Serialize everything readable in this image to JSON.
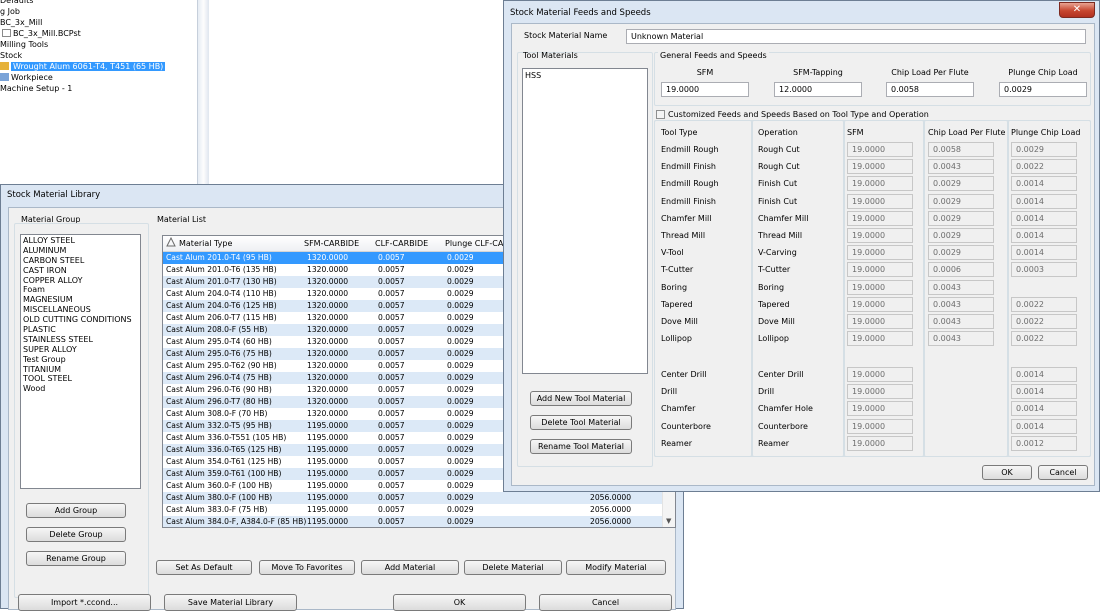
{
  "tree": {
    "items": [
      {
        "label": "Defaults",
        "indent": 0
      },
      {
        "label": "g Job",
        "indent": 0
      },
      {
        "label": "BC_3x_Mill",
        "indent": 0
      },
      {
        "label": "BC_3x_Mill.BCPst",
        "indent": 1
      },
      {
        "label": "Milling Tools",
        "indent": 0
      },
      {
        "label": "Stock",
        "indent": 0
      },
      {
        "label": "Wrought Alum 6061-T4, T451 (65 HB)",
        "indent": 1
      },
      {
        "label": "Workpiece",
        "indent": 1
      },
      {
        "label": "Machine Setup - 1",
        "indent": 0
      }
    ]
  },
  "library": {
    "title": "Stock Material Library",
    "material_group_label": "Material Group",
    "material_list_label": "Material List",
    "groups": [
      "ALLOY STEEL",
      "ALUMINUM",
      "CARBON STEEL",
      "CAST IRON",
      "COPPER ALLOY",
      "Foam",
      "MAGNESIUM",
      "MISCELLANEOUS",
      "OLD CUTTING CONDITIONS",
      "PLASTIC",
      "STAINLESS STEEL",
      "SUPER ALLOY",
      "Test Group",
      "TITANIUM",
      "TOOL STEEL",
      "Wood"
    ],
    "columns": [
      "Material Type",
      "SFM-CARBIDE",
      "CLF-CARBIDE",
      "Plunge CLF-CARBIDE"
    ],
    "rows": [
      [
        "Cast Alum 201.0-T4 (95 HB)",
        "1320.0000",
        "0.0057",
        "0.0029",
        ""
      ],
      [
        "Cast Alum 201.0-T6 (135 HB)",
        "1320.0000",
        "0.0057",
        "0.0029",
        ""
      ],
      [
        "Cast Alum 201.0-T7 (130 HB)",
        "1320.0000",
        "0.0057",
        "0.0029",
        ""
      ],
      [
        "Cast Alum 204.0-T4 (110 HB)",
        "1320.0000",
        "0.0057",
        "0.0029",
        ""
      ],
      [
        "Cast Alum 204.0-T6 (125 HB)",
        "1320.0000",
        "0.0057",
        "0.0029",
        ""
      ],
      [
        "Cast Alum 206.0-T7 (115 HB)",
        "1320.0000",
        "0.0057",
        "0.0029",
        ""
      ],
      [
        "Cast Alum 208.0-F (55 HB)",
        "1320.0000",
        "0.0057",
        "0.0029",
        ""
      ],
      [
        "Cast Alum 295.0-T4 (60 HB)",
        "1320.0000",
        "0.0057",
        "0.0029",
        ""
      ],
      [
        "Cast Alum 295.0-T6 (75 HB)",
        "1320.0000",
        "0.0057",
        "0.0029",
        ""
      ],
      [
        "Cast Alum 295.0-T62 (90 HB)",
        "1320.0000",
        "0.0057",
        "0.0029",
        ""
      ],
      [
        "Cast Alum 296.0-T4 (75 HB)",
        "1320.0000",
        "0.0057",
        "0.0029",
        ""
      ],
      [
        "Cast Alum 296.0-T6 (90 HB)",
        "1320.0000",
        "0.0057",
        "0.0029",
        ""
      ],
      [
        "Cast Alum 296.0-T7 (80 HB)",
        "1320.0000",
        "0.0057",
        "0.0029",
        ""
      ],
      [
        "Cast Alum 308.0-F (70 HB)",
        "1320.0000",
        "0.0057",
        "0.0029",
        ""
      ],
      [
        "Cast Alum 332.0-T5 (95 HB)",
        "1195.0000",
        "0.0057",
        "0.0029",
        ""
      ],
      [
        "Cast Alum 336.0-T551 (105 HB)",
        "1195.0000",
        "0.0057",
        "0.0029",
        ""
      ],
      [
        "Cast Alum 336.0-T65 (125 HB)",
        "1195.0000",
        "0.0057",
        "0.0029",
        ""
      ],
      [
        "Cast Alum 354.0-T61 (125 HB)",
        "1195.0000",
        "0.0057",
        "0.0029",
        ""
      ],
      [
        "Cast Alum 359.0-T61 (100 HB)",
        "1195.0000",
        "0.0057",
        "0.0029",
        ""
      ],
      [
        "Cast Alum 360.0-F (100 HB)",
        "1195.0000",
        "0.0057",
        "0.0029",
        ""
      ],
      [
        "Cast Alum 380.0-F (100 HB)",
        "1195.0000",
        "0.0057",
        "0.0029",
        "2056.0000"
      ],
      [
        "Cast Alum 383.0-F (75 HB)",
        "1195.0000",
        "0.0057",
        "0.0029",
        "2056.0000"
      ],
      [
        "Cast Alum 384.0-F, A384.0-F (85 HB)",
        "1195.0000",
        "0.0057",
        "0.0029",
        "2056.0000"
      ]
    ],
    "add_group": "Add Group",
    "delete_group": "Delete Group",
    "rename_group": "Rename Group",
    "set_default": "Set As Default",
    "move_favorites": "Move To Favorites",
    "add_material": "Add Material",
    "delete_material": "Delete Material",
    "modify_material": "Modify Material",
    "import": "Import *.ccond...",
    "save": "Save Material Library",
    "ok": "OK",
    "cancel": "Cancel"
  },
  "feeds": {
    "title": "Stock Material Feeds and Speeds",
    "close_glyph": "✕",
    "name_label": "Stock Material Name",
    "name_value": "Unknown Material",
    "tool_materials_label": "Tool Materials",
    "tool_materials": [
      "HSS"
    ],
    "general_label": "General Feeds and Speeds",
    "general": [
      {
        "label": "SFM",
        "value": "19.0000"
      },
      {
        "label": "SFM-Tapping",
        "value": "12.0000"
      },
      {
        "label": "Chip Load Per Flute",
        "value": "0.0058"
      },
      {
        "label": "Plunge Chip Load",
        "value": "0.0029"
      }
    ],
    "custom_label": "Customized Feeds and Speeds Based on Tool Type and Operation",
    "custom_headers": [
      "Tool Type",
      "Operation",
      "SFM",
      "Chip Load Per Flute",
      "Plunge Chip Load"
    ],
    "rows": [
      {
        "tool": "Endmill Rough",
        "op": "Rough Cut",
        "sfm": "19.0000",
        "clf": "0.0058",
        "plunge": "0.0029"
      },
      {
        "tool": "Endmill Finish",
        "op": "Rough Cut",
        "sfm": "19.0000",
        "clf": "0.0043",
        "plunge": "0.0022"
      },
      {
        "tool": "Endmill Rough",
        "op": "Finish Cut",
        "sfm": "19.0000",
        "clf": "0.0029",
        "plunge": "0.0014"
      },
      {
        "tool": "Endmill Finish",
        "op": "Finish Cut",
        "sfm": "19.0000",
        "clf": "0.0029",
        "plunge": "0.0014"
      },
      {
        "tool": "Chamfer Mill",
        "op": "Chamfer Mill",
        "sfm": "19.0000",
        "clf": "0.0029",
        "plunge": "0.0014"
      },
      {
        "tool": "Thread Mill",
        "op": "Thread Mill",
        "sfm": "19.0000",
        "clf": "0.0029",
        "plunge": "0.0014"
      },
      {
        "tool": "V-Tool",
        "op": "V-Carving",
        "sfm": "19.0000",
        "clf": "0.0029",
        "plunge": "0.0014"
      },
      {
        "tool": "T-Cutter",
        "op": "T-Cutter",
        "sfm": "19.0000",
        "clf": "0.0006",
        "plunge": "0.0003"
      },
      {
        "tool": "Boring",
        "op": "Boring",
        "sfm": "19.0000",
        "clf": "0.0043",
        "plunge": null
      },
      {
        "tool": "Tapered",
        "op": "Tapered",
        "sfm": "19.0000",
        "clf": "0.0043",
        "plunge": "0.0022"
      },
      {
        "tool": "Dove Mill",
        "op": "Dove Mill",
        "sfm": "19.0000",
        "clf": "0.0043",
        "plunge": "0.0022"
      },
      {
        "tool": "Lollipop",
        "op": "Lollipop",
        "sfm": "19.0000",
        "clf": "0.0043",
        "plunge": "0.0022"
      }
    ],
    "drill_rows": [
      {
        "tool": "Center Drill",
        "op": "Center Drill",
        "sfm": "19.0000",
        "plunge": "0.0014"
      },
      {
        "tool": "Drill",
        "op": "Drill",
        "sfm": "19.0000",
        "plunge": "0.0014"
      },
      {
        "tool": "Chamfer",
        "op": "Chamfer Hole",
        "sfm": "19.0000",
        "plunge": "0.0014"
      },
      {
        "tool": "Counterbore",
        "op": "Counterbore",
        "sfm": "19.0000",
        "plunge": "0.0014"
      },
      {
        "tool": "Reamer",
        "op": "Reamer",
        "sfm": "19.0000",
        "plunge": "0.0012"
      }
    ],
    "add_tool_material": "Add New Tool Material",
    "delete_tool_material": "Delete Tool Material",
    "rename_tool_material": "Rename Tool Material",
    "ok": "OK",
    "cancel": "Cancel"
  }
}
